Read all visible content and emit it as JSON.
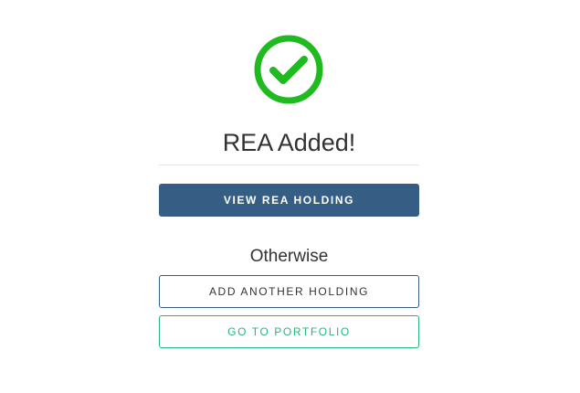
{
  "success": {
    "icon": "check-circle-icon",
    "icon_color": "#1fba1f",
    "title": "REA Added!"
  },
  "actions": {
    "view_holding_label": "VIEW REA HOLDING",
    "otherwise_label": "Otherwise",
    "add_another_label": "ADD ANOTHER HOLDING",
    "portfolio_label": "GO TO PORTFOLIO"
  },
  "colors": {
    "primary": "#365e85",
    "accent_green": "#28b47f"
  }
}
